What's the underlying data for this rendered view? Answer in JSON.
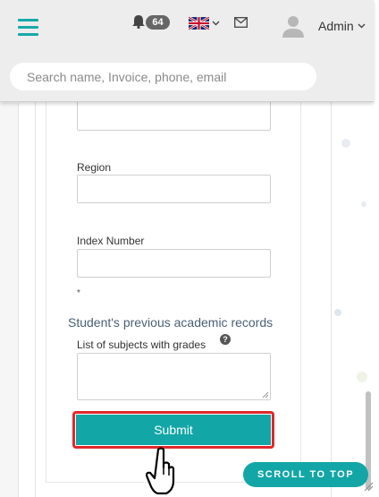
{
  "header": {
    "notification_count": "64",
    "user_name": "Admin",
    "search_placeholder": "Search name, Invoice, phone, email",
    "accent_color": "#13a6a6"
  },
  "form": {
    "region_label": "Region",
    "index_label": "Index Number",
    "required_mark": "*",
    "section_title": "Student's previous academic records",
    "subjects_label": "List of subjects with grades",
    "help_icon_text": "?",
    "submit_label": "Submit"
  },
  "scroll_top_label": "SCROLL TO TOP",
  "icons": [
    "menu-icon",
    "bell-icon",
    "uk-flag-icon",
    "mail-icon",
    "user-avatar-icon",
    "help-icon",
    "pointer-hand-icon"
  ]
}
